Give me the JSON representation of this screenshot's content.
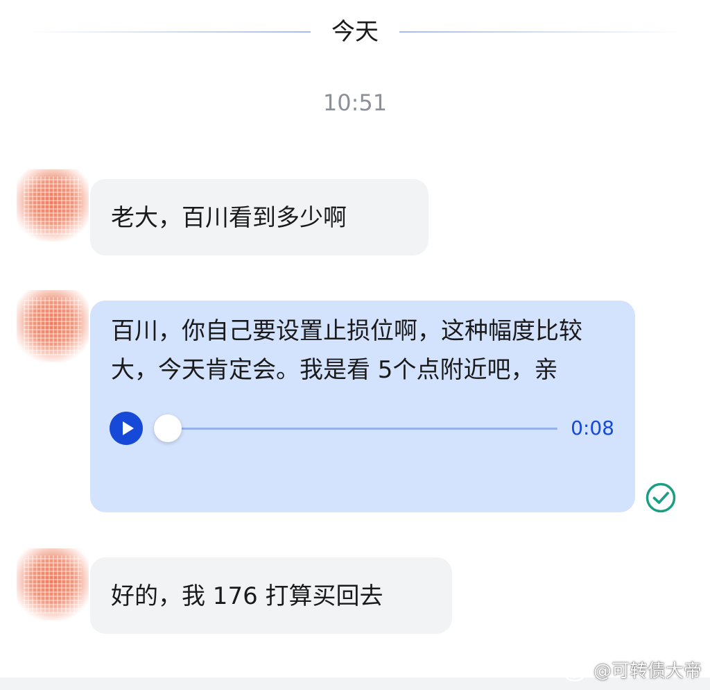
{
  "date_divider": {
    "label": "今天"
  },
  "timestamp": "10:51",
  "messages": [
    {
      "sender": "other",
      "text": "老大，百川看到多少啊"
    },
    {
      "sender": "self",
      "text": "百川，你自己要设置止损位啊，这种幅度比较大，今天肯定会。我是看 5个点附近吧，亲",
      "audio": {
        "duration": "0:08",
        "progress": 0.0
      },
      "status_icon": "check-circle-icon"
    },
    {
      "sender": "other",
      "text": "好的，我 176 打算买回去"
    }
  ],
  "watermark": {
    "text": "@可转债大帝",
    "icon": "weibo-icon"
  },
  "colors": {
    "incoming_bubble": "#f2f3f5",
    "outgoing_bubble": "#d3e2fd",
    "accent": "#1649d8",
    "status_green": "#1a9f82"
  }
}
